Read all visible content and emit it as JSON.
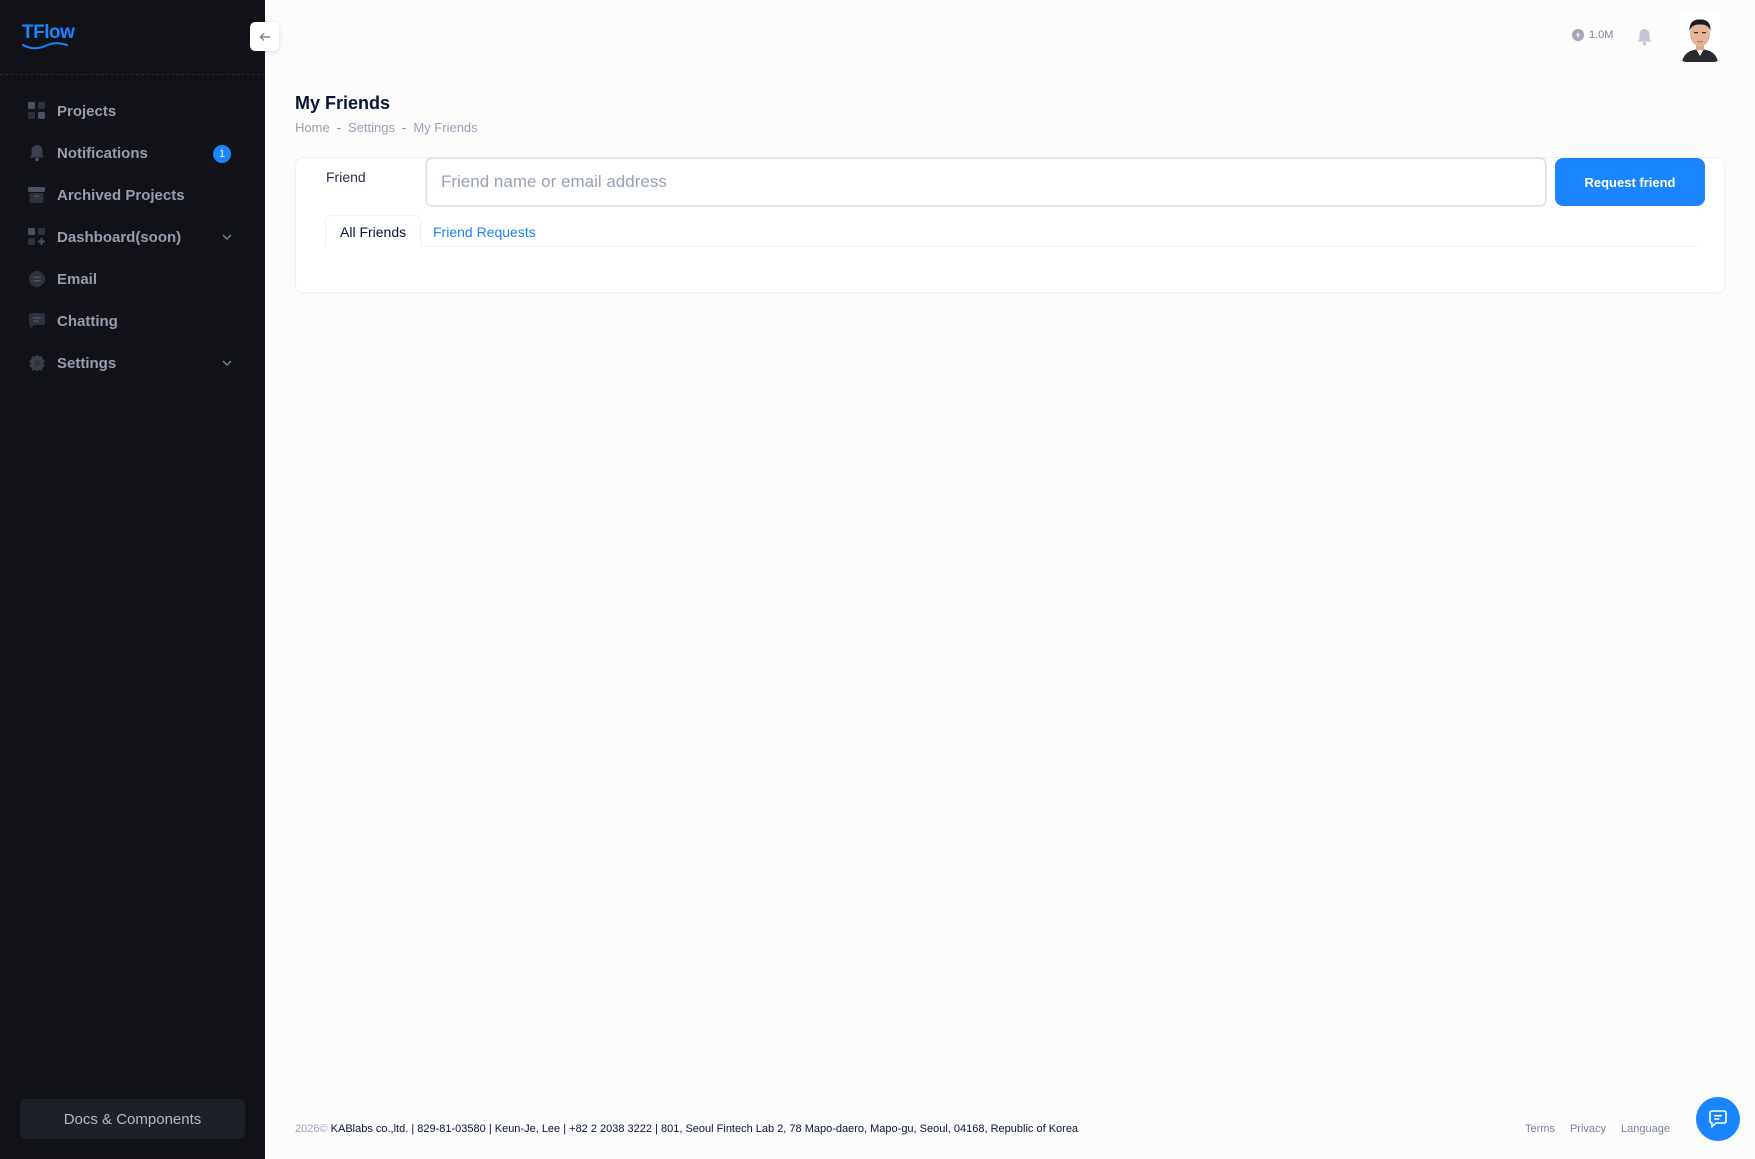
{
  "app": {
    "logo_text": "TFlow",
    "brand_color": "#1b84ff"
  },
  "sidebar": {
    "items": [
      {
        "label": "Projects",
        "icon": "grid-icon"
      },
      {
        "label": "Notifications",
        "icon": "bell-icon",
        "badge": "1"
      },
      {
        "label": "Archived Projects",
        "icon": "archive-icon"
      },
      {
        "label": "Dashboard(soon)",
        "icon": "dashboard-icon",
        "has_children": true
      },
      {
        "label": "Email",
        "icon": "email-icon"
      },
      {
        "label": "Chatting",
        "icon": "chat-icon"
      },
      {
        "label": "Settings",
        "icon": "gear-icon",
        "has_children": true
      }
    ],
    "docs_label": "Docs & Components"
  },
  "header": {
    "token_balance": "1.0M"
  },
  "page": {
    "title": "My Friends",
    "breadcrumb": [
      "Home",
      "Settings",
      "My Friends"
    ]
  },
  "friend_form": {
    "label": "Friend",
    "placeholder": "Friend name or email address",
    "value": "",
    "submit_label": "Request friend"
  },
  "tabs": [
    {
      "label": "All Friends",
      "active": true
    },
    {
      "label": "Friend Requests",
      "active": false
    }
  ],
  "footer": {
    "year": "2026©",
    "company": "KABlabs co.,ltd. | 829-81-03580 | Keun-Je, Lee | +82 2 2038 3222 | 801, Seoul Fintech Lab 2, 78 Mapo-daero, Mapo-gu, Seoul, 04168, Republic of Korea",
    "links": [
      "Terms",
      "Privacy",
      "Language"
    ]
  }
}
